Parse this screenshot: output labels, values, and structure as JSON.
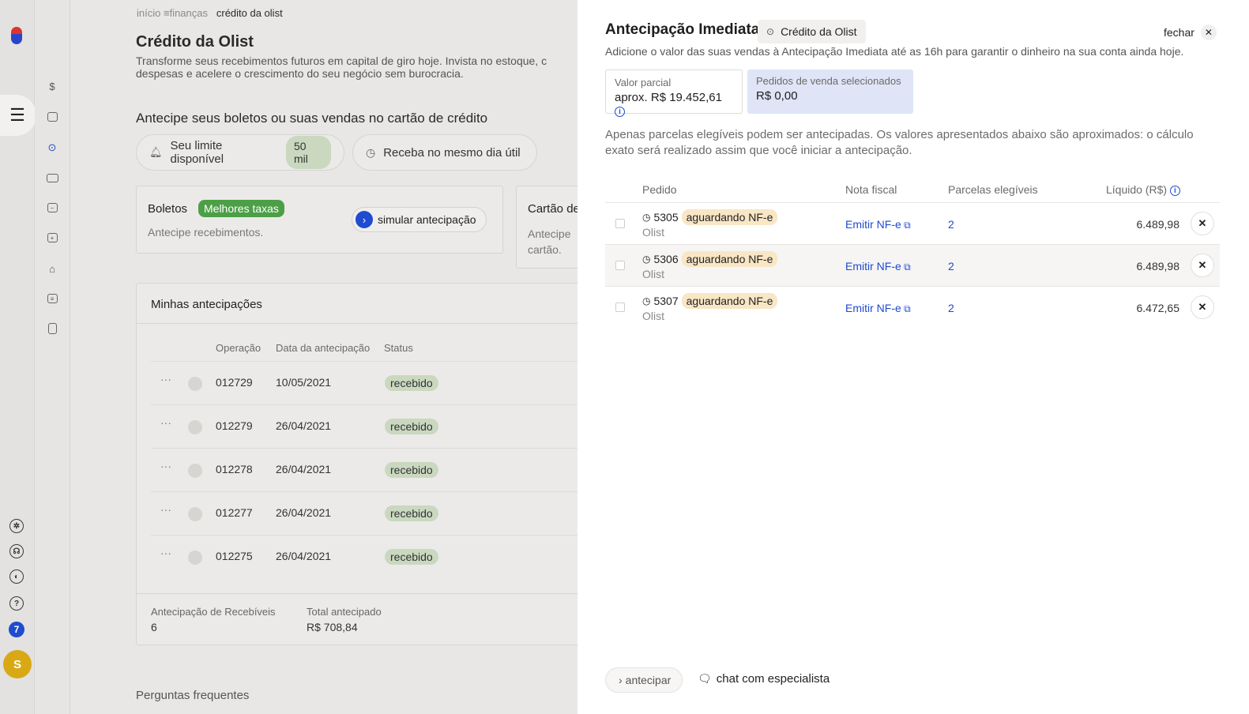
{
  "breadcrumb": {
    "home": "início",
    "section": "finanças",
    "current": "crédito da olist"
  },
  "page": {
    "title": "Crédito da Olist",
    "subtitle_line1": "Transforme seus recebimentos futuros em capital de giro hoje. Invista no estoque, c",
    "subtitle_line2": "despesas e acelere o crescimento do seu negócio sem burocracia.",
    "section_heading": "Antecipe seus boletos ou suas vendas no cartão de crédito",
    "limit_label": "Seu limite disponível",
    "limit_value": "50 mil",
    "same_day_label": "Receba no mesmo dia útil",
    "boletos_card": {
      "title": "Boletos",
      "badge": "Melhores taxas",
      "description": "Antecipe recebimentos.",
      "button": "simular antecipação"
    },
    "cartao_card": {
      "title": "Cartão de",
      "desc_line1": "Antecipe",
      "desc_line2": "cartão."
    },
    "my_anticipations": {
      "title": "Minhas antecipações",
      "columns": [
        "Operação",
        "Data da antecipação",
        "Status"
      ],
      "rows": [
        {
          "op": "012729",
          "date": "10/05/2021",
          "status": "recebido"
        },
        {
          "op": "012279",
          "date": "26/04/2021",
          "status": "recebido"
        },
        {
          "op": "012278",
          "date": "26/04/2021",
          "status": "recebido"
        },
        {
          "op": "012277",
          "date": "26/04/2021",
          "status": "recebido"
        },
        {
          "op": "012275",
          "date": "26/04/2021",
          "status": "recebido"
        }
      ],
      "summary": {
        "count_label": "Antecipação de Recebíveis",
        "count_value": "6",
        "total_label": "Total antecipado",
        "total_value": "R$ 708,84"
      }
    },
    "faq_label": "Perguntas frequentes"
  },
  "sidebar": {
    "notification_count": "7",
    "avatar_initial": "S"
  },
  "drawer": {
    "title": "Antecipação Imediata",
    "chip": "Crédito da Olist",
    "close_label": "fechar",
    "subtitle": "Adicione o valor das suas vendas à Antecipação Imediata até as 16h para garantir o dinheiro na sua conta ainda hoje.",
    "partial_label": "Valor parcial",
    "partial_value": "aprox. R$ 19.452,61",
    "selected_label": "Pedidos de venda selecionados",
    "selected_value": "R$ 0,00",
    "note_line1": "Apenas parcelas elegíveis podem ser antecipadas. Os valores apresentados abaixo são aproximados: o cálculo",
    "note_line2": "exato será realizado assim que você iniciar a antecipação.",
    "columns": {
      "order": "Pedido",
      "invoice": "Nota fiscal",
      "installments": "Parcelas elegíveis",
      "net": "Líquido (R$)"
    },
    "orders": [
      {
        "id": "5305",
        "status": "aguardando NF-e",
        "store": "Olist",
        "invoice_action": "Emitir NF-e",
        "installments": "2",
        "net": "6.489,98"
      },
      {
        "id": "5306",
        "status": "aguardando NF-e",
        "store": "Olist",
        "invoice_action": "Emitir NF-e",
        "installments": "2",
        "net": "6.489,98"
      },
      {
        "id": "5307",
        "status": "aguardando NF-e",
        "store": "Olist",
        "invoice_action": "Emitir NF-e",
        "installments": "2",
        "net": "6.472,65"
      }
    ],
    "anticipate_button": "antecipar",
    "chat_button": "chat com especialista"
  }
}
